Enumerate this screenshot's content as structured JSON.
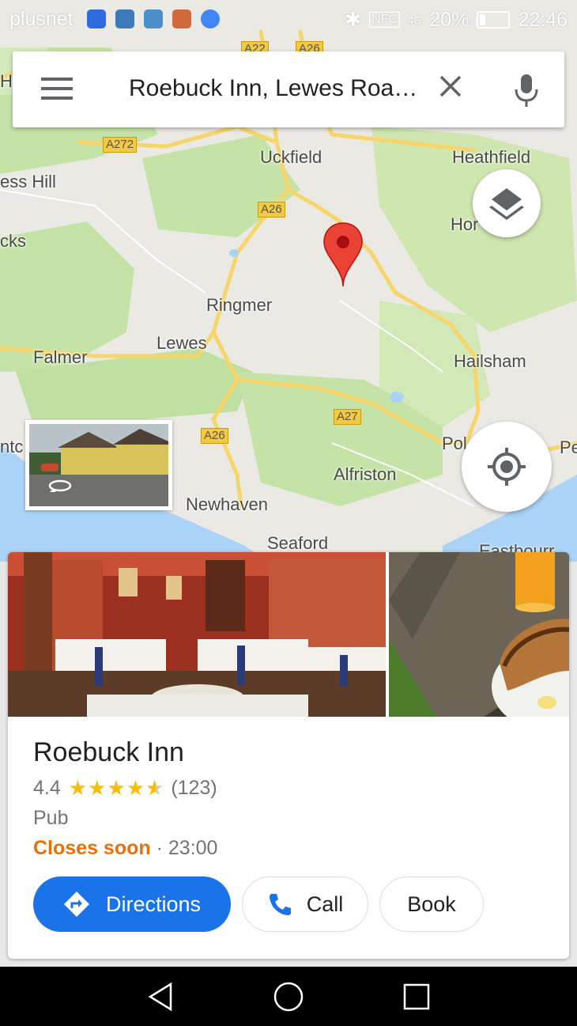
{
  "status_bar": {
    "carrier": "plusnet",
    "bluetooth": "✱",
    "nfc": "NFC",
    "network": "4G",
    "battery": "20%",
    "time": "22:46"
  },
  "search": {
    "query": "Roebuck Inn, Lewes Roa…"
  },
  "map": {
    "labels": {
      "uckfield": "Uckfield",
      "heathfield": "Heathfield",
      "ringmer": "Ringmer",
      "lewes": "Lewes",
      "falmer": "Falmer",
      "hailsham": "Hailsham",
      "alfriston": "Alfriston",
      "newhaven": "Newhaven",
      "seaford": "Seaford",
      "hill": "ess Hill",
      "cks": "cks",
      "hor": "Hor",
      "pol": "Pol",
      "pe": "Pe",
      "ha": "Ha",
      "ntc": "ntc",
      "eastbourne": "Eastbourr"
    },
    "roads": {
      "a22": "A22",
      "a26_top": "A26",
      "a272": "A272",
      "a26_mid": "A26",
      "a26_south": "A26",
      "a27": "A27"
    }
  },
  "place": {
    "name": "Roebuck Inn",
    "rating": "4.4",
    "review_count": "(123)",
    "stars": "★★★★",
    "category": "Pub",
    "status": "Closes soon",
    "separator": "·",
    "closing_time": "23:00"
  },
  "actions": {
    "directions": "Directions",
    "call": "Call",
    "book": "Book"
  },
  "colors": {
    "accent": "#1a73e8",
    "status_orange": "#e8710a",
    "star": "#fbbc04",
    "pin": "#ea4335"
  }
}
